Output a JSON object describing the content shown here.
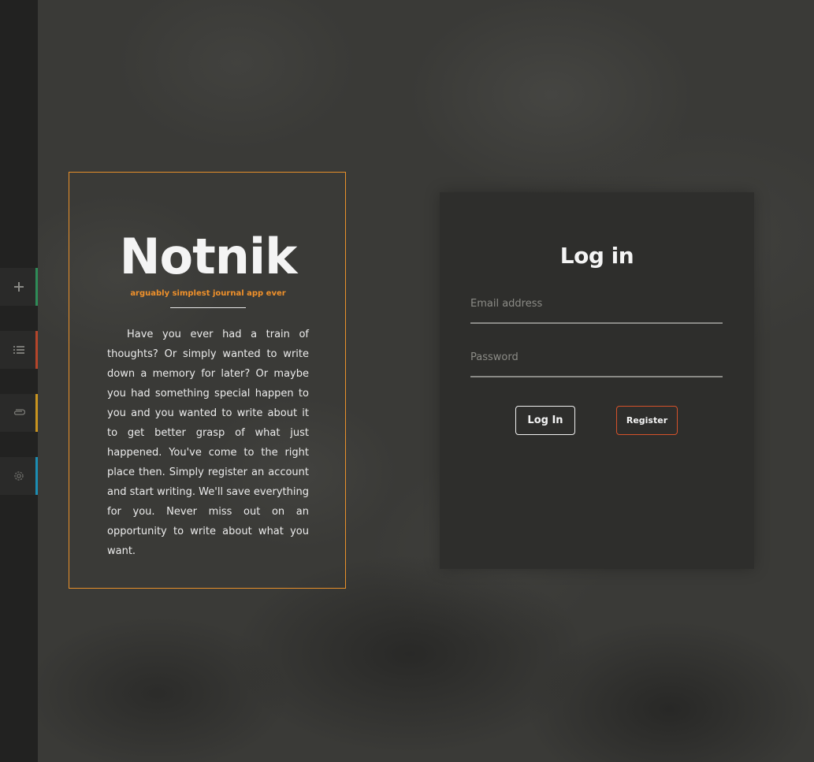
{
  "sidebar": {
    "items": [
      {
        "icon": "plus-icon",
        "accent": "#2e8b57"
      },
      {
        "icon": "list-icon",
        "accent": "#b5452a"
      },
      {
        "icon": "paperclip-icon",
        "accent": "#c9941f"
      },
      {
        "icon": "gear-icon",
        "accent": "#1c8db3"
      }
    ]
  },
  "intro": {
    "logo": "Notnik",
    "tagline": "arguably simplest journal app ever",
    "text": "Have you ever had a train of thoughts? Or simply wanted to write down a memory for later? Or maybe you had something special happen to you and you wanted to write about it to get better grasp of what just happened. You've come to the right place then. Simply register an account and start writing. We'll save everything for you. Never miss out on an opportunity to write about what you want."
  },
  "login": {
    "title": "Log in",
    "email_placeholder": "Email address",
    "password_placeholder": "Password",
    "login_label": "Log In",
    "register_label": "Register"
  },
  "colors": {
    "accent_orange": "#f0912b",
    "register_border": "#d5522b"
  }
}
